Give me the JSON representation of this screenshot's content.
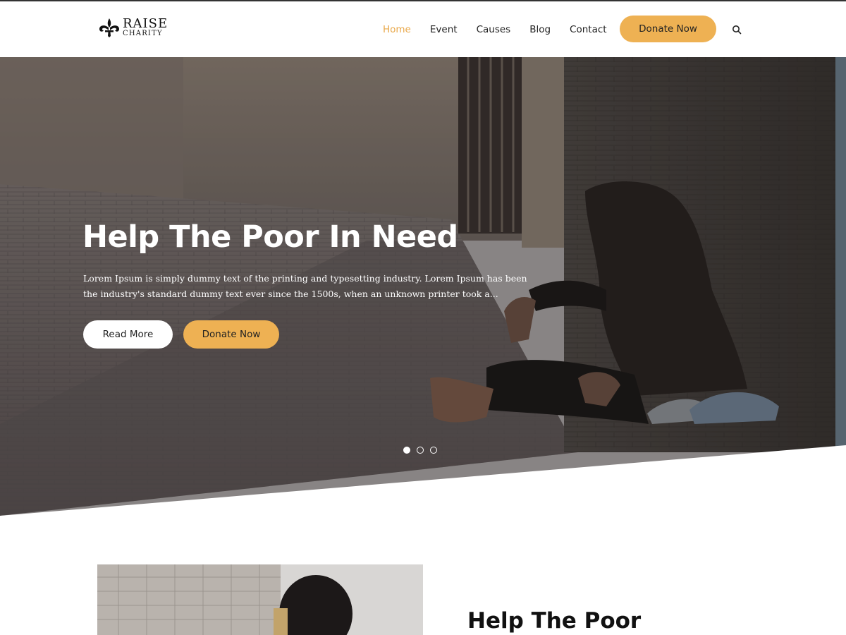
{
  "brand": {
    "title": "RAISE",
    "subtitle": "CHARITY"
  },
  "nav": {
    "items": [
      {
        "label": "Home",
        "active": true
      },
      {
        "label": "Event",
        "active": false
      },
      {
        "label": "Causes",
        "active": false
      },
      {
        "label": "Blog",
        "active": false
      },
      {
        "label": "Contact",
        "active": false
      }
    ],
    "donate_label": "Donate Now",
    "search_icon": "search-icon"
  },
  "hero": {
    "title": "Help The Poor In Need",
    "text": "Lorem Ipsum is simply dummy text of the printing and typesetting industry. Lorem Ipsum has been the industry's standard dummy text ever since the 1500s, when an unknown printer took a...",
    "read_more_label": "Read More",
    "donate_label": "Donate Now",
    "slides_total": 3,
    "slide_active": 1
  },
  "section": {
    "title": "Help The Poor"
  },
  "colors": {
    "accent": "#eeb153",
    "nav_active": "#e9a84a"
  }
}
